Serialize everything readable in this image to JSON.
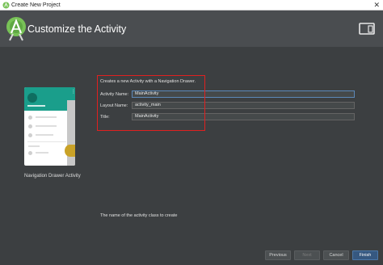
{
  "window": {
    "title": "Create New Project"
  },
  "header": {
    "title": "Customize the Activity"
  },
  "template": {
    "name": "Navigation Drawer Activity"
  },
  "form": {
    "description": "Creates a new Activity with a Navigation Drawer.",
    "fields": [
      {
        "label": "Activity Name:",
        "value": "MainActivity"
      },
      {
        "label": "Layout Name:",
        "value": "activity_main"
      },
      {
        "label": "Title:",
        "value": "MainActivity"
      }
    ],
    "hint": "The name of the activity class to create"
  },
  "buttons": {
    "previous": "Previous",
    "next": "Next",
    "cancel": "Cancel",
    "finish": "Finish"
  },
  "colors": {
    "accent": "#1a9e8b",
    "highlight_box": "#e02020",
    "primary_button": "#365880"
  },
  "icons": {
    "app": "android-studio-icon",
    "logo": "android-studio-logo",
    "device": "tablet-device-icon",
    "close": "close-icon"
  }
}
